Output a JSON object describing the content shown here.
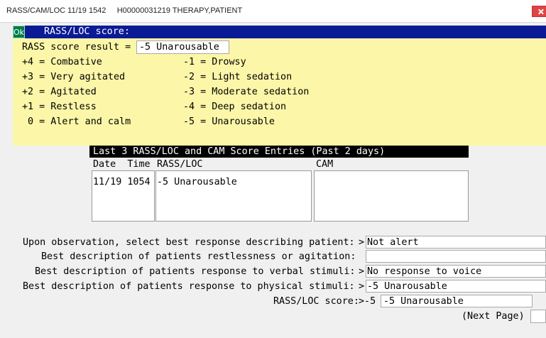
{
  "window": {
    "title": "RASS/CAM/LOC 11/19 1542     H00000031219 THERAPY,PATIENT"
  },
  "header": {
    "ok_label": "Ok",
    "title": "RASS/LOC score:"
  },
  "score_result": {
    "label": "RASS score result =",
    "value": "-5 Unarousable"
  },
  "scale": {
    "left": [
      "+4 = Combative",
      "+3 = Very agitated",
      "+2 = Agitated",
      "+1 = Restless",
      " 0 = Alert and calm"
    ],
    "right": [
      "-1 = Drowsy",
      "-2 = Light sedation",
      "-3 = Moderate sedation",
      "-4 = Deep sedation",
      "-5 = Unarousable"
    ]
  },
  "history": {
    "title": "Last 3 RASS/LOC and CAM Score Entries (Past 2 days)",
    "headers": {
      "datetime": "Date  Time",
      "rass": "RASS/LOC",
      "cam": "CAM"
    },
    "rows": [
      {
        "datetime": "11/19 1054",
        "rass": "-5 Unarousable",
        "cam": ""
      }
    ]
  },
  "questions": [
    {
      "label": "Upon observation, select best response describing patient:",
      "prefix": ">",
      "value": "Not alert"
    },
    {
      "label": "Best description of patients restlessness or agitation:",
      "prefix": "",
      "value": ""
    },
    {
      "label": "Best description of patients response to verbal stimuli:",
      "prefix": ">",
      "value": "No response to voice"
    },
    {
      "label": "Best description of patients response to physical stimuli:",
      "prefix": ">",
      "value": "-5 Unarousable"
    }
  ],
  "rass_score": {
    "label": "RASS/LOC score:",
    "prefix": ">-5",
    "value": "-5 Unarousable"
  },
  "next_page": {
    "label": "(Next Page)",
    "value": ""
  },
  "colors": {
    "header_bg": "#0b1b96",
    "panel_bg": "#fcf7a8",
    "ok_bg": "#007c4a",
    "close_bg": "#e04343"
  }
}
